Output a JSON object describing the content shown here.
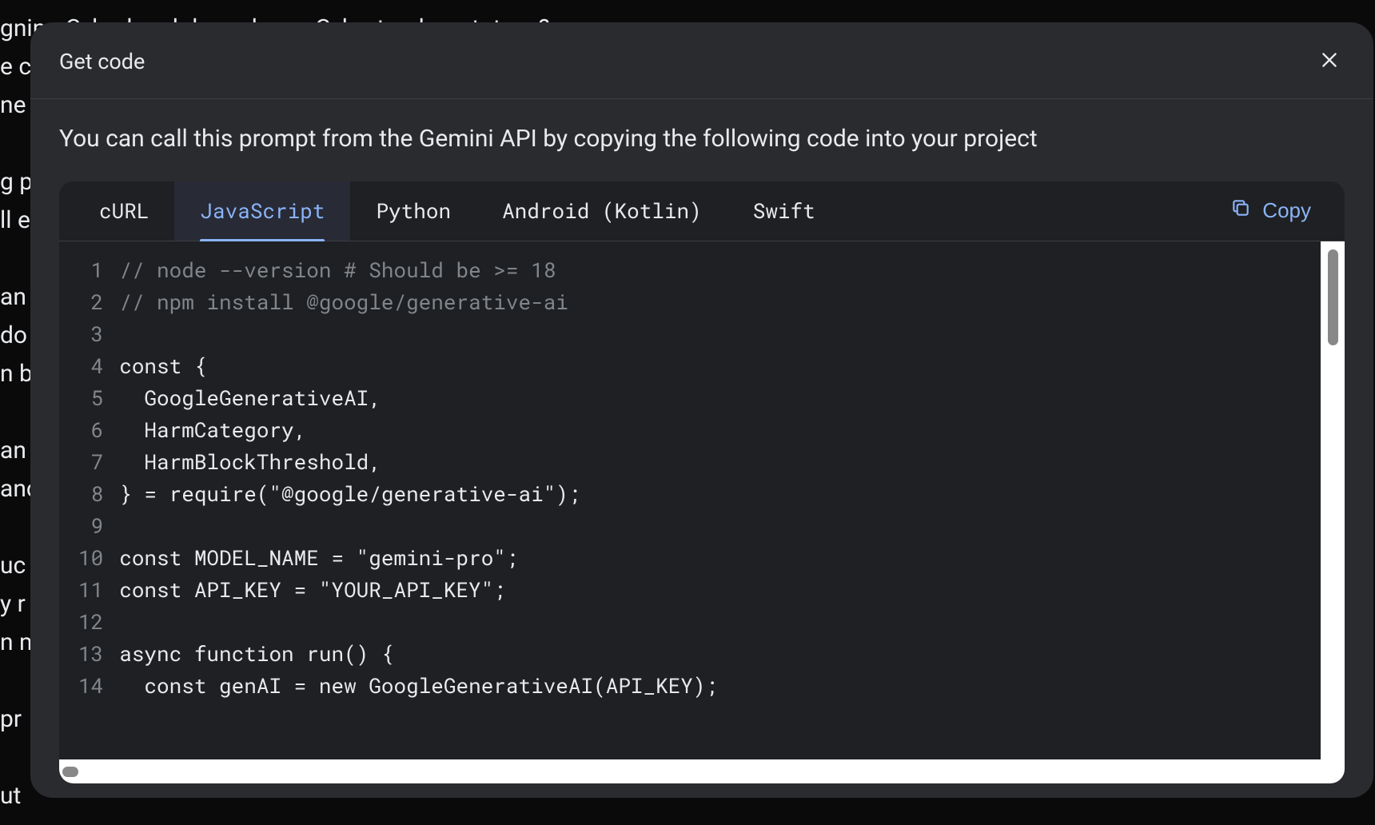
{
  "background": {
    "lines": [
      "gning Cyberl andr based on a Cybertruck prototype?",
      "e c",
      "ne",
      "",
      "g p",
      "ll e",
      "",
      "an",
      "do",
      "n b",
      "",
      "an",
      "anc",
      "",
      "uc",
      "y r",
      "n m",
      "",
      "pr",
      "",
      "ut"
    ]
  },
  "modal": {
    "title": "Get code",
    "description": "You can call this prompt from the Gemini API by copying the following code into your project",
    "tabs": [
      {
        "label": "cURL",
        "active": false
      },
      {
        "label": "JavaScript",
        "active": true
      },
      {
        "label": "Python",
        "active": false
      },
      {
        "label": "Android (Kotlin)",
        "active": false
      },
      {
        "label": "Swift",
        "active": false
      }
    ],
    "copy_label": "Copy",
    "code_lines": [
      {
        "n": 1,
        "t": "// node --version # Should be >= 18",
        "cls": "comment"
      },
      {
        "n": 2,
        "t": "// npm install @google/generative-ai",
        "cls": "comment"
      },
      {
        "n": 3,
        "t": "",
        "cls": ""
      },
      {
        "n": 4,
        "t": "const {",
        "cls": ""
      },
      {
        "n": 5,
        "t": "  GoogleGenerativeAI,",
        "cls": ""
      },
      {
        "n": 6,
        "t": "  HarmCategory,",
        "cls": ""
      },
      {
        "n": 7,
        "t": "  HarmBlockThreshold,",
        "cls": ""
      },
      {
        "n": 8,
        "t": "} = require(\"@google/generative-ai\");",
        "cls": ""
      },
      {
        "n": 9,
        "t": "",
        "cls": ""
      },
      {
        "n": 10,
        "t": "const MODEL_NAME = \"gemini-pro\";",
        "cls": ""
      },
      {
        "n": 11,
        "t": "const API_KEY = \"YOUR_API_KEY\";",
        "cls": ""
      },
      {
        "n": 12,
        "t": "",
        "cls": ""
      },
      {
        "n": 13,
        "t": "async function run() {",
        "cls": ""
      },
      {
        "n": 14,
        "t": "  const genAI = new GoogleGenerativeAI(API_KEY);",
        "cls": ""
      }
    ]
  }
}
